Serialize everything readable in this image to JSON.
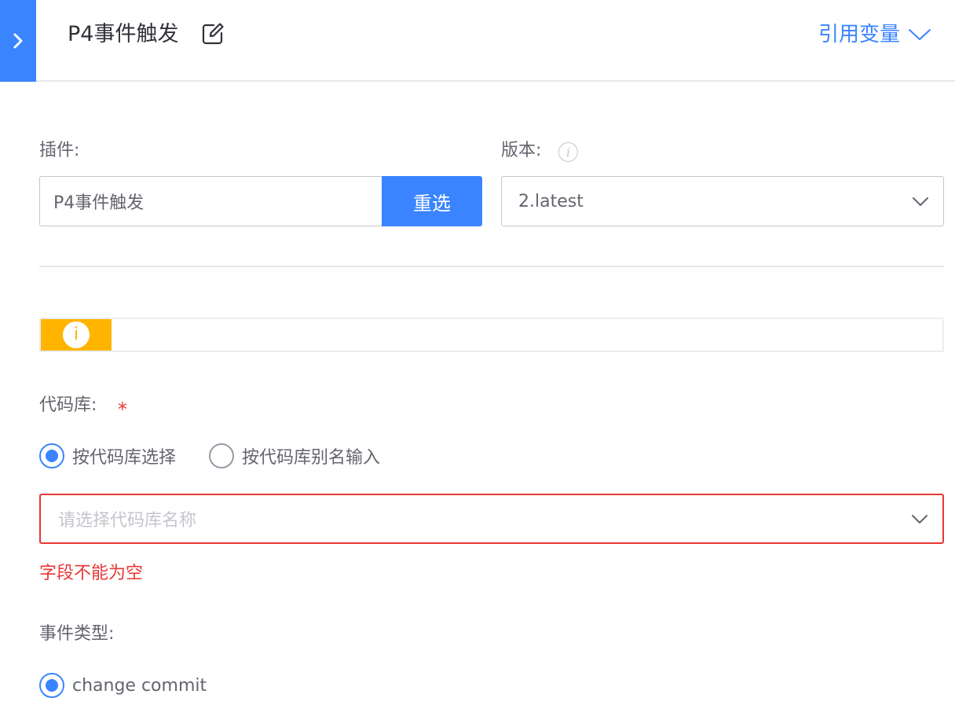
{
  "header": {
    "title": "P4事件触发",
    "ref_var_label": "引用变量"
  },
  "plugin": {
    "label": "插件:",
    "value": "P4事件触发",
    "reselect_label": "重选"
  },
  "version": {
    "label": "版本:",
    "info_icon_glyph": "i",
    "value": "2.latest"
  },
  "notice": {
    "icon_glyph": "i",
    "color": "#ffb400"
  },
  "repo": {
    "label": "代码库:",
    "required_mark": "*",
    "options": [
      {
        "label": "按代码库选择",
        "checked": true
      },
      {
        "label": "按代码库别名输入",
        "checked": false
      }
    ],
    "placeholder": "请选择代码库名称",
    "error": "字段不能为空"
  },
  "event_type": {
    "label": "事件类型:",
    "options": [
      {
        "label": "change commit",
        "checked": true
      }
    ]
  },
  "colors": {
    "primary": "#3a84ff",
    "error": "#ea3636",
    "warning": "#ffb400"
  }
}
